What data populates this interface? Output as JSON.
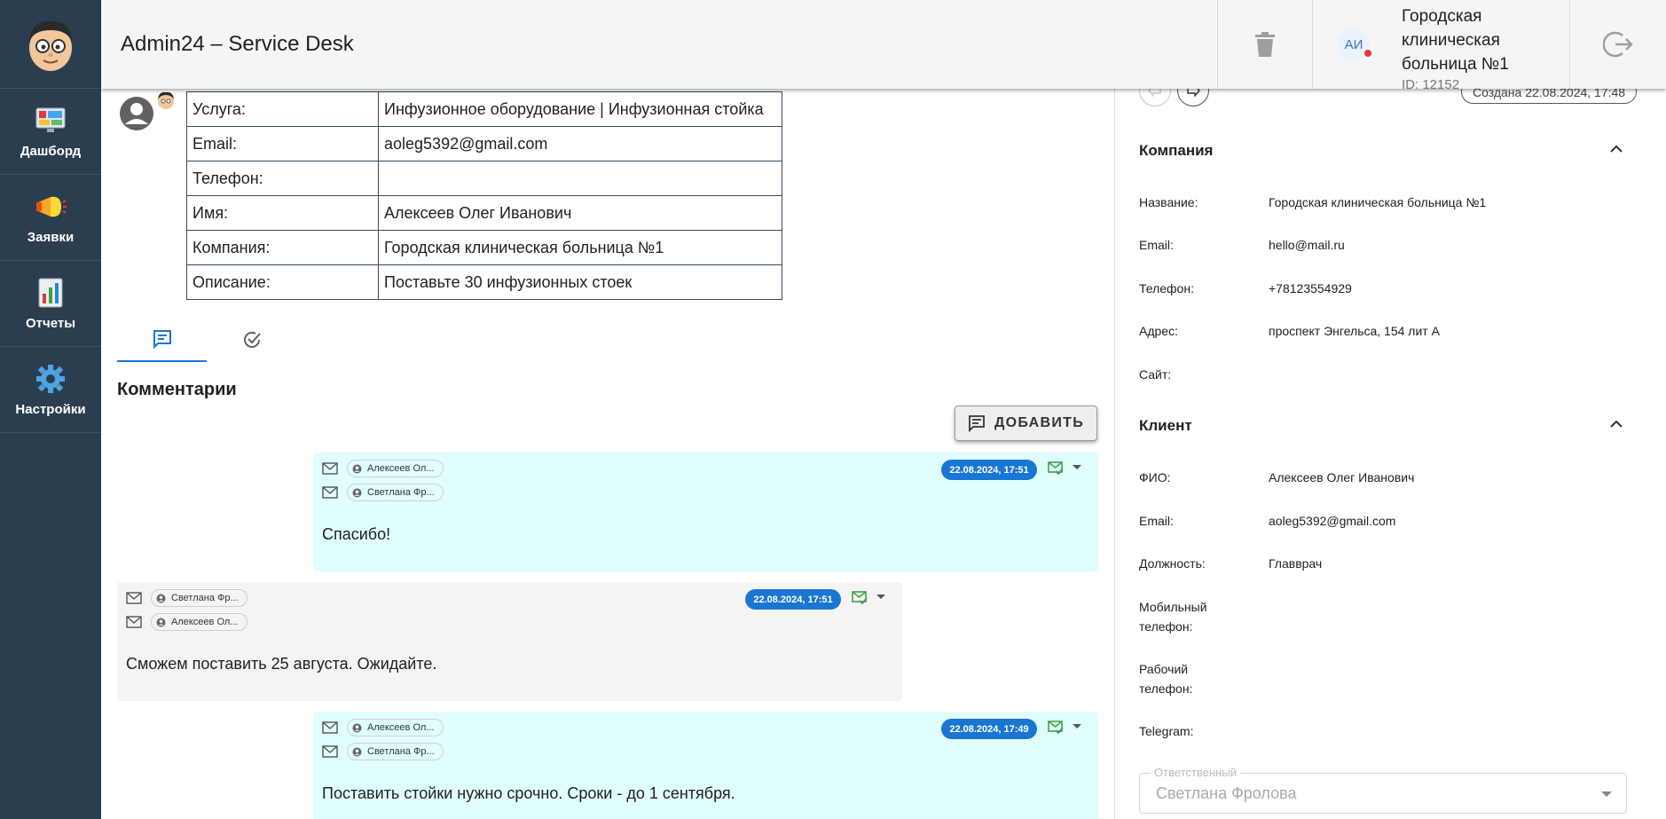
{
  "app": {
    "title": "Admin24 – Service Desk"
  },
  "sidebar": {
    "items": [
      {
        "label": "Дашборд",
        "icon": "dashboard-icon"
      },
      {
        "label": "Заявки",
        "icon": "megaphone-icon"
      },
      {
        "label": "Отчеты",
        "icon": "report-icon"
      },
      {
        "label": "Настройки",
        "icon": "gear-icon"
      }
    ]
  },
  "header": {
    "client_initials": "АИ",
    "client_name": "Городская клиническая больница №1",
    "client_id": "ID: 12152"
  },
  "ticket_info": {
    "rows": [
      {
        "key": "Услуга:",
        "value": "Инфузионное оборудование | Инфузионная стойка"
      },
      {
        "key": "Email:",
        "value": "aoleg5392@gmail.com"
      },
      {
        "key": "Телефон:",
        "value": ""
      },
      {
        "key": "Имя:",
        "value": "Алексеев Олег Иванович"
      },
      {
        "key": "Компания:",
        "value": "Городская клиническая больница №1"
      },
      {
        "key": "Описание:",
        "value": "Поставьте 30 инфузионных стоек"
      }
    ]
  },
  "comments": {
    "title": "Комментарии",
    "add_label": "ДОБАВИТЬ",
    "items": [
      {
        "from": "Алексеев Ол...",
        "to": "Светлана Фр...",
        "date": "22.08.2024, 17:51",
        "text": "Спасибо!"
      },
      {
        "from": "Светлана Фр...",
        "to": "Алексеев Ол...",
        "date": "22.08.2024, 17:51",
        "text": "Сможем поставить 25 августа. Ожидайте."
      },
      {
        "from": "Алексеев Ол...",
        "to": "Светлана Фр...",
        "date": "22.08.2024, 17:49",
        "text": "Поставить стойки нужно срочно. Сроки - до 1 сентября."
      }
    ]
  },
  "right_panel": {
    "created": "Создана 22.08.2024, 17:48",
    "company": {
      "title": "Компания",
      "fields": [
        {
          "label": "Название:",
          "value": "Городская клиническая больница №1"
        },
        {
          "label": "Email:",
          "value": "hello@mail.ru"
        },
        {
          "label": "Телефон:",
          "value": "+78123554929"
        },
        {
          "label": "Адрес:",
          "value": "проспект Энгельса, 154 лит А"
        },
        {
          "label": "Сайт:",
          "value": ""
        }
      ]
    },
    "client": {
      "title": "Клиент",
      "fields": [
        {
          "label": "ФИО:",
          "value": "Алексеев Олег Иванович"
        },
        {
          "label": "Email:",
          "value": "aoleg5392@gmail.com"
        },
        {
          "label": "Должность:",
          "value": "Главврач"
        },
        {
          "label": "Мобильный телефон:",
          "value": ""
        },
        {
          "label": "Рабочий телефон:",
          "value": ""
        },
        {
          "label": "Telegram:",
          "value": ""
        }
      ]
    },
    "responsible": {
      "label": "Ответственный",
      "value": "Светлана Фролова"
    }
  },
  "colors": {
    "sidebar": "#2b3e50",
    "accent": "#1976d2",
    "incoming_bg": "#e0fefe",
    "outgoing_bg": "#f4f4f4",
    "mail_ok": "#43a047"
  }
}
